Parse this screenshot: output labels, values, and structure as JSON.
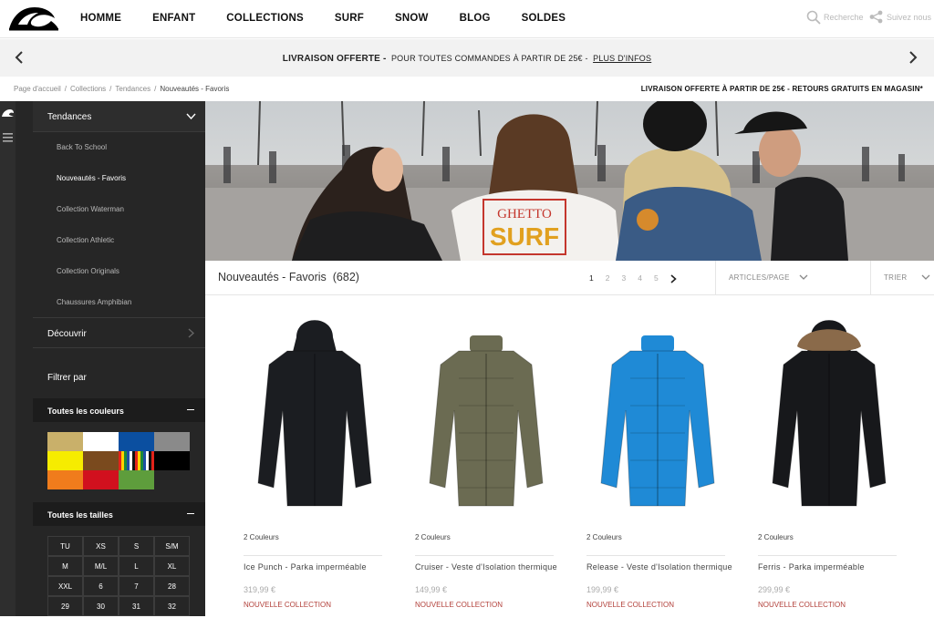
{
  "nav": {
    "items": [
      "HOMME",
      "ENFANT",
      "COLLECTIONS",
      "SURF",
      "SNOW",
      "BLOG",
      "SOLDES"
    ],
    "search_label": "Recherche",
    "follow_label": "Suivez nous"
  },
  "promo": {
    "bold": "LIVRAISON OFFERTE -",
    "text": "POUR TOUTES COMMANDES À PARTIR DE 25€ -",
    "link": "PLUS D'INFOS"
  },
  "breadcrumb": {
    "items": [
      "Page d'accueil",
      "/",
      "Collections",
      "/",
      "Tendances",
      "/",
      "Nouveautés - Favoris"
    ]
  },
  "shipping_note": "LIVRAISON OFFERTE À PARTIR DE 25€ - RETOURS GRATUITS EN MAGASIN*",
  "sidebar": {
    "trend_title": "Tendances",
    "trend_items": [
      "Back To School",
      "Nouveautés - Favoris",
      "Collection Waterman",
      "Collection Athletic",
      "Collection Originals",
      "Chaussures Amphibian"
    ],
    "discover": "Découvrir",
    "filter_by": "Filtrer par",
    "colors_title": "Toutes les couleurs",
    "colors": [
      "#c9b06a",
      "#ffffff",
      "#0b4fa0",
      "#8a8a8a",
      "#f6ec00",
      "#7a4a1e",
      "multi",
      "#000000",
      "#f07c1c",
      "#d1101e",
      "#5e9d3c"
    ],
    "sizes_title": "Toutes les tailles",
    "sizes": [
      "TU",
      "XS",
      "S",
      "S/M",
      "M",
      "M/L",
      "L",
      "XL",
      "XXL",
      "6",
      "7",
      "28",
      "29",
      "30",
      "31",
      "32"
    ]
  },
  "listing": {
    "title": "Nouveautés - Favoris",
    "count": "(682)",
    "pages": [
      "1",
      "2",
      "3",
      "4",
      "5"
    ],
    "per_page": "ARTICLES/PAGE",
    "sort": "TRIER"
  },
  "products": [
    {
      "colors": "2 Couleurs",
      "name": "Ice Punch - Parka imperméable",
      "price": "319,99 €",
      "tag": "NOUVELLE COLLECTION",
      "color": "#1b1d21"
    },
    {
      "colors": "2 Couleurs",
      "name": "Cruiser - Veste d'Isolation thermique",
      "price": "149,99 €",
      "tag": "NOUVELLE COLLECTION",
      "color": "#6b6b52"
    },
    {
      "colors": "2 Couleurs",
      "name": "Release - Veste d'Isolation thermique",
      "price": "199,99 €",
      "tag": "NOUVELLE COLLECTION",
      "color": "#1f8ad6"
    },
    {
      "colors": "2 Couleurs",
      "name": "Ferris - Parka imperméable",
      "price": "299,99 €",
      "tag": "NOUVELLE COLLECTION",
      "color": "#17181b"
    }
  ],
  "hero": {
    "shirt_text": "GHETTO SURF"
  }
}
